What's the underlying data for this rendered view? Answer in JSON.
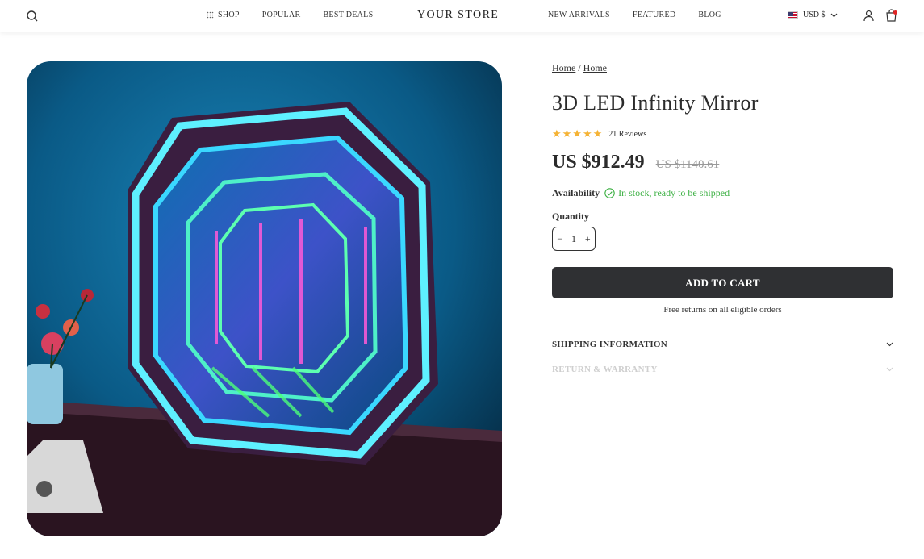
{
  "header": {
    "logo": "YOUR STORE",
    "nav_left": [
      {
        "label": "SHOP",
        "icon": "grid-icon"
      },
      {
        "label": "POPULAR"
      },
      {
        "label": "BEST DEALS"
      }
    ],
    "nav_right": [
      {
        "label": "NEW ARRIVALS"
      },
      {
        "label": "FEATURED"
      },
      {
        "label": "BLOG"
      }
    ],
    "currency": "USD $",
    "icons": [
      "search-icon",
      "us-flag-icon",
      "chevron-down-icon",
      "account-icon",
      "cart-icon"
    ]
  },
  "product": {
    "breadcrumb": [
      "Home",
      "Home"
    ],
    "title": "3D LED Infinity Mirror",
    "rating_stars": 5,
    "reviews": "21 Reviews",
    "price": "US $912.49",
    "compare_price": "US $1140.61",
    "availability_label": "Availability",
    "availability_status": "In stock, ready to be shipped",
    "quantity_label": "Quantity",
    "quantity": "1",
    "add_to_cart": "ADD TO CART",
    "returns_note": "Free returns on all eligible orders",
    "accordions": [
      "SHIPPING INFORMATION",
      "RETURN & WARRANTY"
    ]
  },
  "colors": {
    "primary_button": "#2f3033",
    "in_stock": "#3cb043",
    "stars": "#f5b335",
    "cart_badge": "#e02424"
  }
}
